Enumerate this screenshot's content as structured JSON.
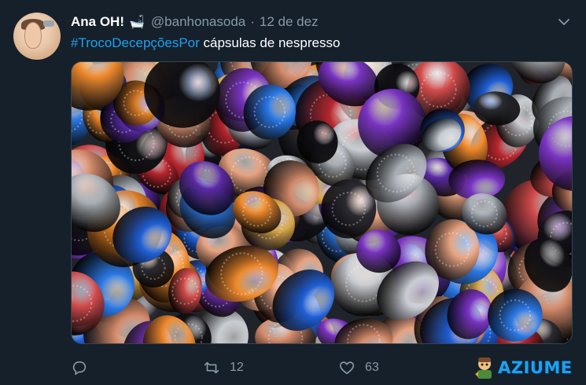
{
  "tweet": {
    "author_name": "Ana OH!",
    "author_badge": "🛁",
    "handle": "@banhonasoda",
    "separator": "·",
    "date": "12 de dez",
    "hashtag": "#TrocoDecepçõesPor",
    "text": " cápsulas de nespresso",
    "media_alt": "pile of nespresso capsules",
    "reply_count": "",
    "retweet_count": "12",
    "like_count": "63"
  },
  "icons": {
    "more": "chevron-down-icon",
    "reply": "reply-icon",
    "retweet": "retweet-icon",
    "like": "heart-icon"
  },
  "watermark": {
    "text": "AZIUME"
  },
  "colors": {
    "background": "#15202b",
    "accent": "#1da1f2",
    "muted": "#8899a6"
  }
}
